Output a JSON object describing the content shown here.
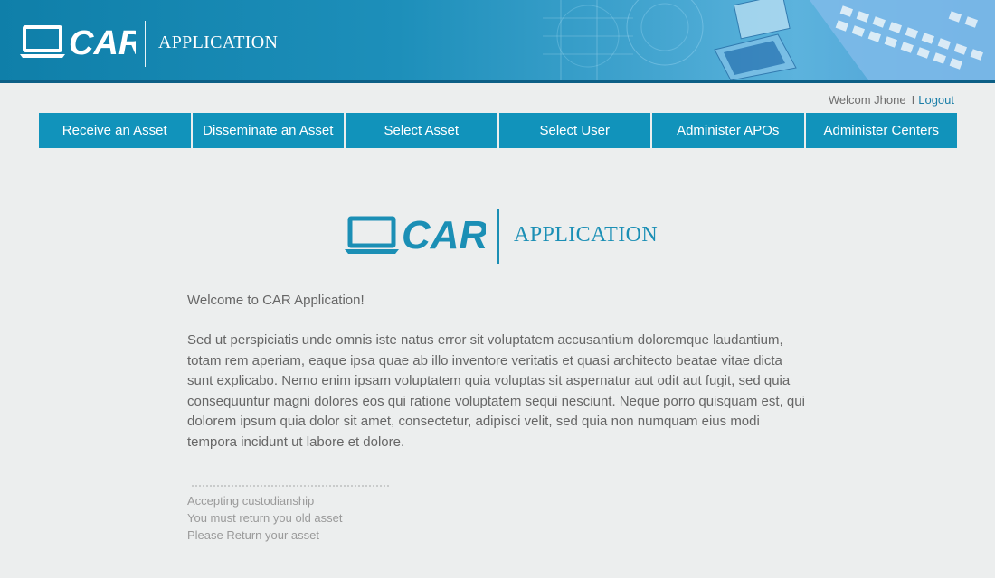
{
  "header": {
    "logo_text": "CAR",
    "app_label": "APPLICATION"
  },
  "userbar": {
    "welcome": "Welcom Jhone",
    "separator": "I",
    "logout": "Logout"
  },
  "nav": {
    "items": [
      "Receive an Asset",
      "Disseminate an Asset",
      "Select Asset",
      "Select User",
      "Administer APOs",
      "Administer Centers"
    ]
  },
  "main": {
    "logo_text": "CAR",
    "app_label": "APPLICATION",
    "welcome": "Welcome to CAR Application!",
    "paragraph": "Sed ut perspiciatis unde omnis iste natus error sit voluptatem accusantium doloremque laudantium, totam rem aperiam, eaque ipsa quae ab illo inventore veritatis et quasi architecto beatae vitae dicta sunt explicabo. Nemo enim ipsam voluptatem quia voluptas sit aspernatur aut odit aut fugit, sed quia consequuntur magni dolores eos qui ratione voluptatem sequi nesciunt. Neque porro quisquam est, qui dolorem ipsum quia dolor sit amet, consectetur, adipisci velit, sed quia non numquam eius modi tempora incidunt ut labore et dolore.",
    "notes": [
      "Accepting custodianship",
      "You must return you old asset",
      "Please Return your asset"
    ]
  },
  "colors": {
    "brand": "#1193bb",
    "link": "#1a7ea8",
    "background": "#eceeee"
  }
}
